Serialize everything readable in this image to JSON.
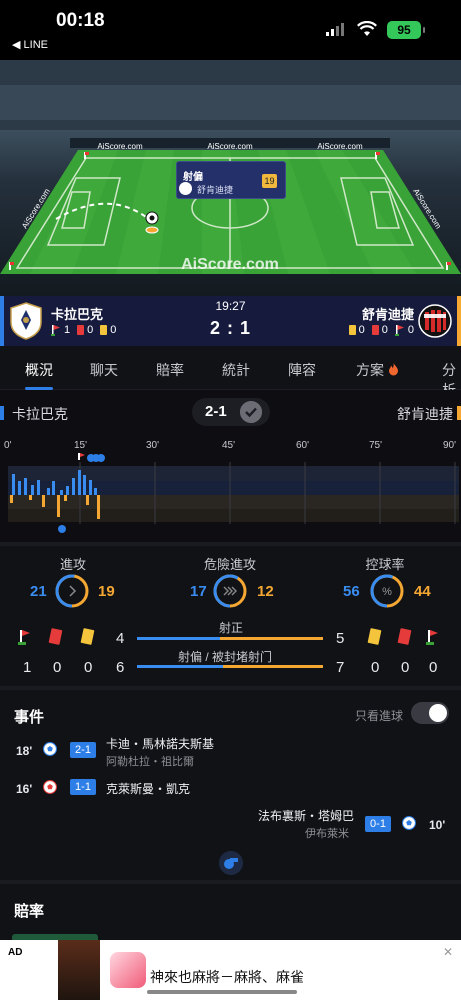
{
  "status_bar": {
    "time": "00:18",
    "back_app": "◀ LINE",
    "battery": "95"
  },
  "pitch": {
    "ad_boards": [
      "AiScore.com",
      "AiScore.com",
      "AiScore.com",
      "AiScore.com",
      "AiScore.com"
    ],
    "watermark": "AiScore.com",
    "event_popup": {
      "title": "射偏",
      "team": "舒肯迪捷",
      "minute": "19"
    }
  },
  "scoreboard": {
    "home_name": "卡拉巴克",
    "away_name": "舒肯迪捷",
    "clock": "19:27",
    "score": "2 : 1",
    "home_corners": "1",
    "home_red": "0",
    "home_yellow": "0",
    "away_yellow": "0",
    "away_red": "0",
    "away_corners": "0"
  },
  "tabs": [
    "概況",
    "聊天",
    "賠率",
    "統計",
    "陣容",
    "方案",
    "分析"
  ],
  "timeline": {
    "home": "卡拉巴克",
    "away": "舒肯迪捷",
    "score": "2-1",
    "minutes": [
      "0'",
      "15'",
      "30'",
      "45'",
      "60'",
      "75'",
      "90'"
    ]
  },
  "stats": {
    "attack": {
      "label": "進攻",
      "home": "21",
      "away": "19",
      "home_fraction": 0.525
    },
    "dangerous": {
      "label": "危險進攻",
      "home": "17",
      "away": "12",
      "home_fraction": 0.586
    },
    "possession": {
      "label": "控球率",
      "home": "56",
      "away": "44",
      "home_fraction": 0.56,
      "symbol": "%"
    },
    "home_counts": {
      "corners": "1",
      "red": "0",
      "yellow": "0"
    },
    "away_counts": {
      "yellow": "0",
      "red": "0",
      "corners": "0"
    },
    "on_target": {
      "label": "射正",
      "home": "4",
      "away": "5",
      "home_fraction": 0.444
    },
    "off_target": {
      "label": "射偏 / 被封堵射门",
      "home": "6",
      "away": "7",
      "home_fraction": 0.462
    }
  },
  "events": {
    "title": "事件",
    "only_goals": "只看進球",
    "items": [
      {
        "minute": "18'",
        "score": "2-1",
        "player": "卡迪・馬林諾夫斯基",
        "assist": "阿勒杜拉・祖比爾"
      },
      {
        "minute": "16'",
        "score": "1-1",
        "player": "克萊斯曼・凱克",
        "assist": ""
      },
      {
        "minute": "10'",
        "score": "0-1",
        "player": "法布裏斯・塔姆巴",
        "assist": "伊布萊米"
      }
    ]
  },
  "odds": {
    "title": "賠率"
  },
  "ad": {
    "label": "AD",
    "text": "神來也麻將－麻將、麻雀"
  },
  "colors": {
    "home": "#3a8df0",
    "away": "#f5a733",
    "accent": "#2d7ee6"
  }
}
